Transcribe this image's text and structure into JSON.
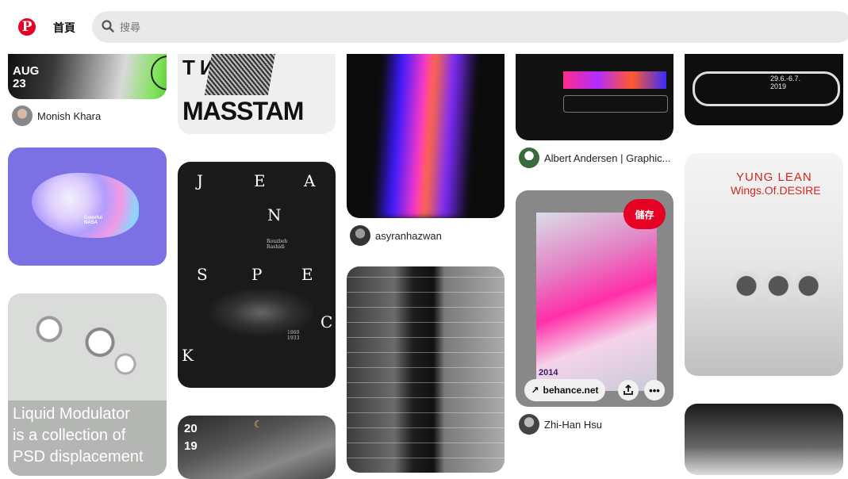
{
  "header": {
    "logo_letter": "P",
    "home_label": "首頁",
    "search_placeholder": "搜尋"
  },
  "pins": {
    "aug": {
      "text": "AUG 23",
      "author": "Monish Khara"
    },
    "masstam": {
      "title": "MASSTAM",
      "top_text": "ТИ КИ"
    },
    "colorful": {
      "label": "Colorful NASA"
    },
    "jeanspeck": {
      "letters": [
        "J",
        "E",
        "A",
        "N",
        "S",
        "P",
        "E",
        "C",
        "K"
      ],
      "names": "Rouzbeh Rashidi",
      "years": "1860 1933"
    },
    "glass": {
      "text1": "Liquid Modulator",
      "text2": "is a collection of",
      "text3": "PSD displacement"
    },
    "night": {
      "year": "20 19"
    },
    "neon": {
      "author": "asyranhazwan"
    },
    "bw_art": {},
    "love_poster": {
      "author": "Albert Andersen | Graphic..."
    },
    "abppw": {
      "save_label": "儲存",
      "link_label": "behance.net",
      "year": "2014",
      "author": "Zhi-Han Hsu"
    },
    "wave": {
      "dates": "29.6.-6.7. 2019"
    },
    "yung_lean": {
      "title1": "YUNG LEAN",
      "title2": "Wings.Of.DESIRE"
    }
  }
}
